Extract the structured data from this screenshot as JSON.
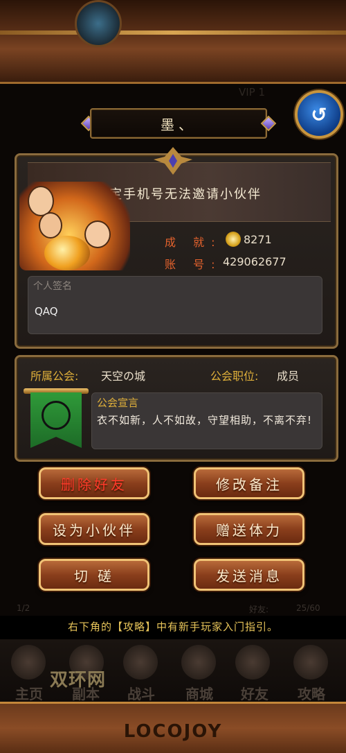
{
  "nameplate": {
    "name": "墨、"
  },
  "profile": {
    "notice": "您未绑定手机号无法邀请小伙伴",
    "achievement_label": "成 就:",
    "achievement_value": "8271",
    "account_label": "账 号:",
    "account_value": "429062677",
    "signature_label": "个人签名",
    "signature_text": "QAQ"
  },
  "guild": {
    "name_label": "所属公会:",
    "name_value": "天空の城",
    "role_label": "公会职位:",
    "role_value": "成员",
    "declaration_title": "公会宣言",
    "declaration_text": "衣不如新，人不如故，守望相助，不离不弃!"
  },
  "actions": {
    "delete_friend": "删除好友",
    "edit_note": "修改备注",
    "set_partner": "设为小伙伴",
    "gift_stamina": "赠送体力",
    "spar": "切 磋",
    "send_message": "发送消息"
  },
  "background": {
    "page_indicator": "1/2",
    "friends_label": "好友:",
    "friends_count": "25/60",
    "vip_label": "VIP 1"
  },
  "hint": "右下角的【攻略】中有新手玩家入门指引。",
  "nav": [
    {
      "label": "主页",
      "icon": "home-icon"
    },
    {
      "label": "副本",
      "icon": "dungeon-icon"
    },
    {
      "label": "战斗",
      "icon": "battle-icon"
    },
    {
      "label": "商城",
      "icon": "shop-icon"
    },
    {
      "label": "好友",
      "icon": "friends-icon"
    },
    {
      "label": "攻略",
      "icon": "guide-icon"
    }
  ],
  "watermark": "双环网",
  "footer": {
    "logo": "LOCOJOY"
  },
  "colors": {
    "accent_gold": "#e0b03a",
    "danger_red": "#ff3a2a",
    "button_brown": "#8a3f1c",
    "back_blue": "#1f63c4"
  }
}
